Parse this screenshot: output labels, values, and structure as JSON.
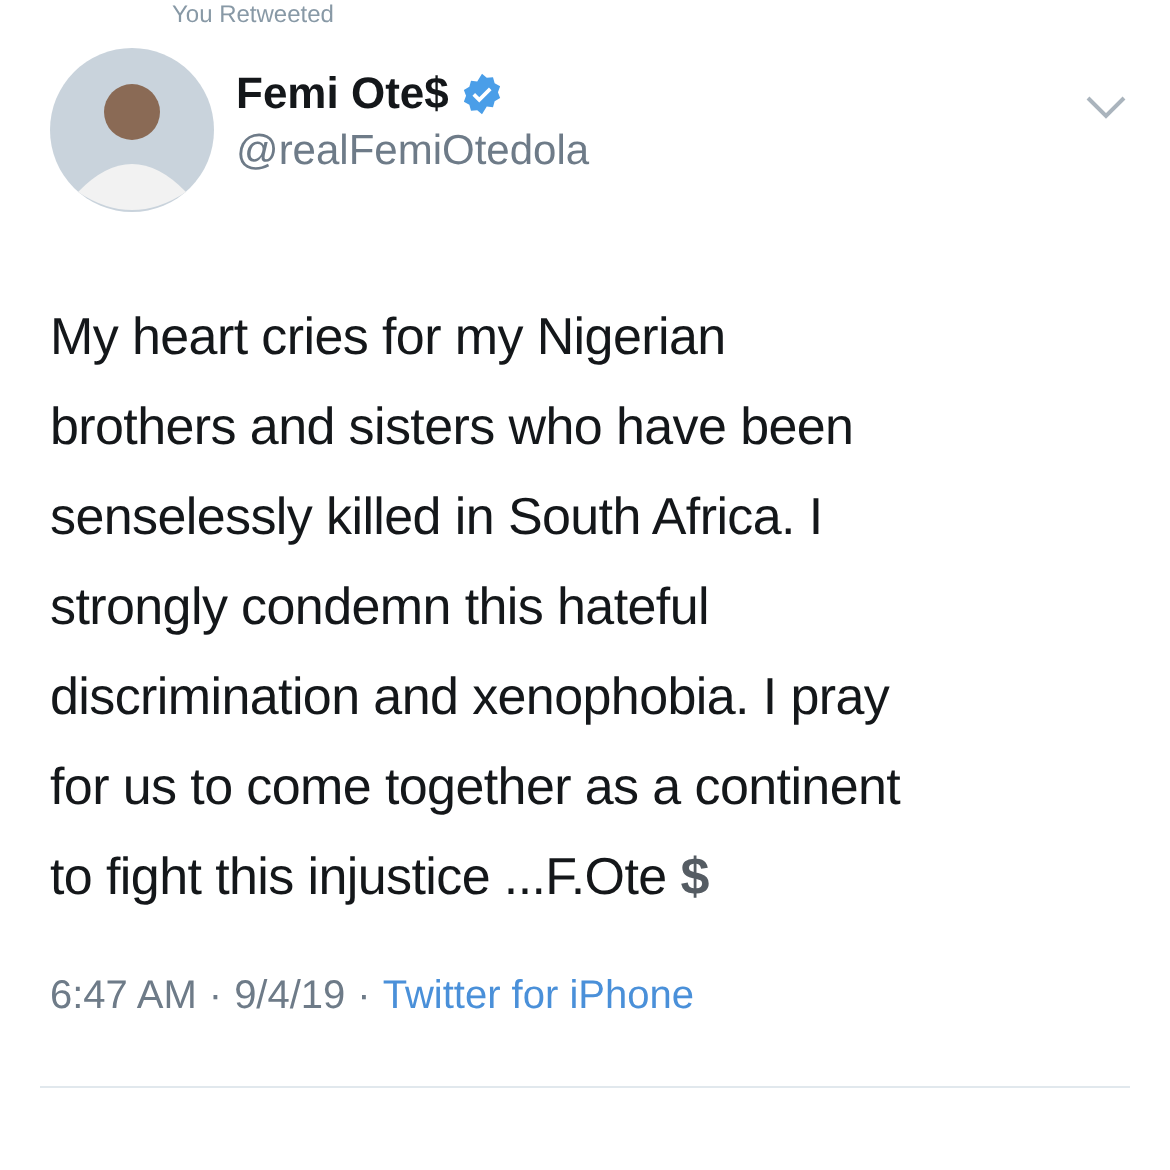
{
  "retweet_notice": "You Retweeted",
  "author": {
    "name": "Femi Ote$",
    "verified": true,
    "handle": "@realFemiOtedola"
  },
  "tweet": {
    "lines": [
      "My heart cries for my Nigerian",
      "brothers and sisters who have been",
      "senselessly killed in South Africa. I",
      "strongly condemn this hateful",
      "discrimination and xenophobia. I pray",
      "for us to come together as a continent",
      "to fight this injustice ...F.Ote"
    ],
    "emoji": "$"
  },
  "meta": {
    "separator": "·",
    "time": "6:47 AM",
    "date": "9/4/19",
    "source": "Twitter for iPhone"
  }
}
